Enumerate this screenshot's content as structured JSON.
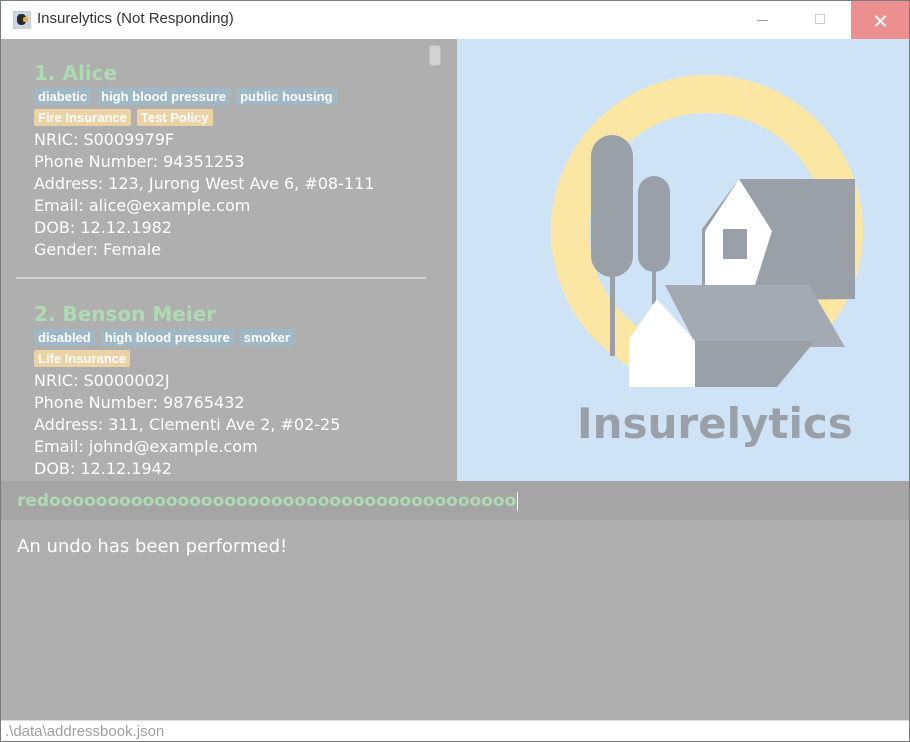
{
  "window": {
    "title": "Insurelytics (Not Responding)"
  },
  "persons": [
    {
      "index_name": "1.  Alice",
      "tags": [
        "diabetic",
        "high blood pressure",
        "public housing"
      ],
      "policies": [
        "Fire Insurance",
        "Test Policy"
      ],
      "nric": "NRIC: S0009979F",
      "phone": "Phone Number: 94351253",
      "address": "Address: 123, Jurong West Ave 6, #08-111",
      "email": "Email: alice@example.com",
      "dob": "DOB: 12.12.1982",
      "gender": "Gender: Female"
    },
    {
      "index_name": "2.  Benson Meier",
      "tags": [
        "disabled",
        "high blood pressure",
        "smoker"
      ],
      "policies": [
        "Life Insurance"
      ],
      "nric": "NRIC: S0000002J",
      "phone": "Phone Number: 98765432",
      "address": "Address: 311, Clementi Ave 2, #02-25",
      "email": "Email: johnd@example.com",
      "dob": "DOB: 12.12.1942"
    }
  ],
  "logo": {
    "brand": "Insurelytics"
  },
  "command": {
    "value": "redoooooooooooooooooooooooooooooooooooooooo"
  },
  "result": {
    "message": "An undo has been performed!"
  },
  "status_bar": {
    "path": ".\\data\\addressbook.json"
  },
  "colors": {
    "name_text": "#aedbb1",
    "tag_bg": "#9fb8c8",
    "policy_bg": "#ecd3a5",
    "panel_bg": "#afafaf",
    "logo_bg": "#cfe3f7"
  }
}
